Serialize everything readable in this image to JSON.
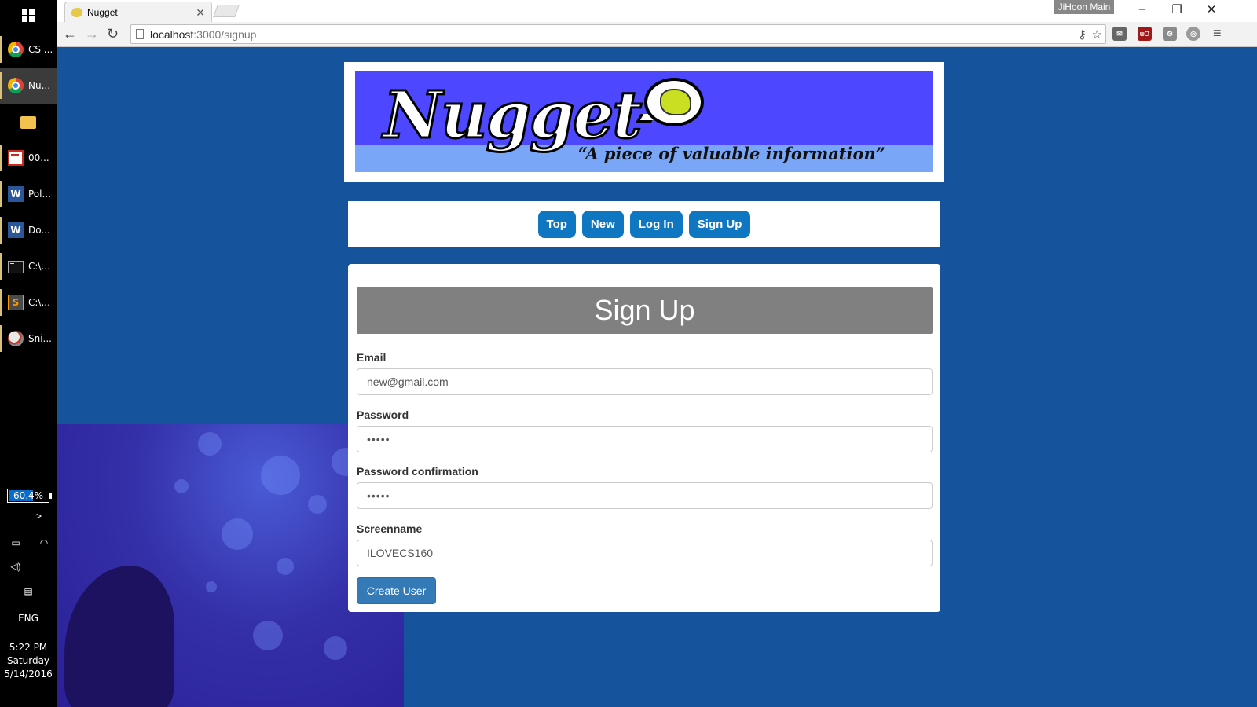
{
  "taskbar": {
    "items": [
      {
        "label": "CS ...",
        "icon": "chrome-icon"
      },
      {
        "label": "Nu...",
        "icon": "chrome-icon"
      },
      {
        "label": "",
        "icon": "folder-icon"
      },
      {
        "label": "00...",
        "icon": "pdf-icon"
      },
      {
        "label": "Pol...",
        "icon": "word-icon"
      },
      {
        "label": "Do...",
        "icon": "word-icon"
      },
      {
        "label": "C:\\...",
        "icon": "cmd-icon"
      },
      {
        "label": "C:\\...",
        "icon": "sublime-icon"
      },
      {
        "label": "Sni...",
        "icon": "snipping-tool-icon"
      }
    ],
    "word_icon_letter": "W",
    "sublime_icon_letter": "S",
    "battery_percent": "60.4%",
    "battery_level": 0.604,
    "language": "ENG",
    "clock": {
      "time": "5:22 PM",
      "day": "Saturday",
      "date": "5/14/2016"
    }
  },
  "browser": {
    "tab_title": "Nugget",
    "profile_name": "JiHoon Main",
    "url_host": "localhost",
    "url_rest": ":3000/signup"
  },
  "banner": {
    "logo_text": "Nugget",
    "tagline": "“A piece of valuable information”"
  },
  "nav": {
    "items": [
      "Top",
      "New",
      "Log In",
      "Sign Up"
    ]
  },
  "form": {
    "title": "Sign Up",
    "fields": [
      {
        "label": "Email",
        "value": "new@gmail.com"
      },
      {
        "label": "Password",
        "value": "•••••"
      },
      {
        "label": "Password confirmation",
        "value": "•••••"
      },
      {
        "label": "Screenname",
        "value": "ILOVECS160"
      }
    ],
    "submit_label": "Create User"
  },
  "colors": {
    "page_background": "#15539c",
    "banner_background": "#4d47ff",
    "nav_button": "#0f76c2",
    "submit_button": "#337ab7",
    "form_header": "#808080"
  }
}
